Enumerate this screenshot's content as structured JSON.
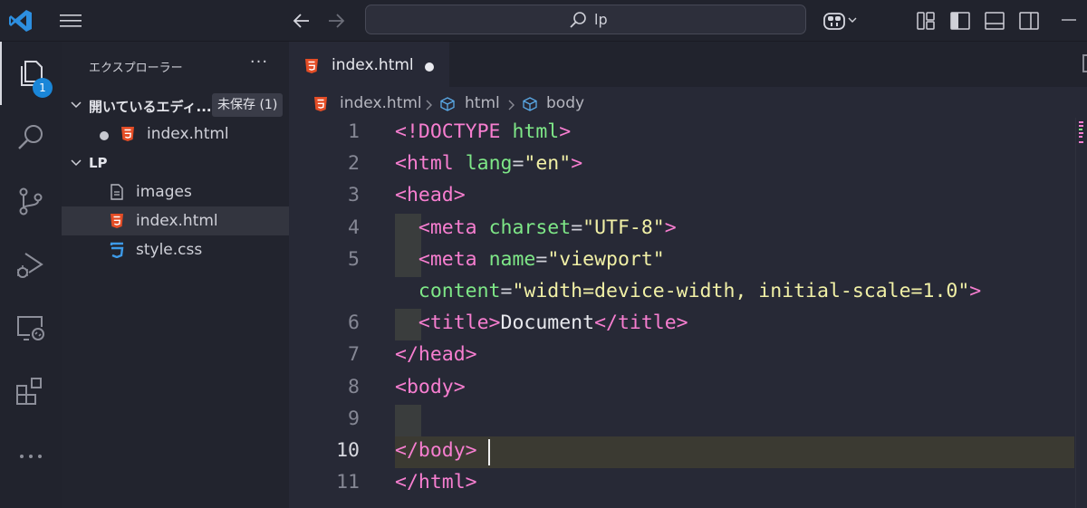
{
  "titlebar": {
    "search_text": "lp",
    "icons": [
      "vscode-logo-icon",
      "hamburger-menu-icon",
      "arrow-left-icon",
      "arrow-right-icon",
      "search-icon",
      "copilot-icon",
      "chevron-down-icon",
      "customize-layout-icon",
      "toggle-primary-sidebar-icon",
      "toggle-panel-icon",
      "toggle-secondary-sidebar-icon",
      "minimize-icon"
    ]
  },
  "activitybar": {
    "explorer_badge": "1",
    "items": [
      "explorer-icon",
      "search-icon",
      "source-control-icon",
      "run-debug-icon",
      "remote-explorer-icon",
      "extensions-icon",
      "more-icon"
    ]
  },
  "sidebar": {
    "title": "エクスプローラー",
    "more": "···",
    "open_editors": {
      "label": "開いているエディ...",
      "unsaved_badge": "未保存 (1)",
      "files": [
        {
          "name": "index.html",
          "dirty": true
        }
      ]
    },
    "folder": {
      "label": "LP",
      "items": [
        {
          "name": "images",
          "icon": "file-icon"
        },
        {
          "name": "index.html",
          "icon": "html5-icon"
        },
        {
          "name": "style.css",
          "icon": "css3-icon"
        }
      ]
    }
  },
  "editor": {
    "tab": {
      "name": "index.html",
      "dirty": true
    },
    "breadcrumb": [
      "index.html",
      "html",
      "body"
    ],
    "current_line": "10",
    "lines": [
      {
        "n": "1",
        "tokens": [
          [
            "t-tag",
            "<!DOCTYPE"
          ],
          [
            "t-plain",
            " "
          ],
          [
            "t-attr",
            "html"
          ],
          [
            "t-tag",
            ">"
          ]
        ]
      },
      {
        "n": "2",
        "tokens": [
          [
            "t-tag",
            "<html"
          ],
          [
            "t-plain",
            " "
          ],
          [
            "t-attr",
            "lang"
          ],
          [
            "t-eq",
            "="
          ],
          [
            "t-str",
            "\"en\""
          ],
          [
            "t-tag",
            ">"
          ]
        ]
      },
      {
        "n": "3",
        "tokens": [
          [
            "t-tag",
            "<head>"
          ]
        ]
      },
      {
        "n": "4",
        "indent": true,
        "tokens": [
          [
            "t-plain",
            "  "
          ],
          [
            "t-tag",
            "<meta"
          ],
          [
            "t-plain",
            " "
          ],
          [
            "t-attr",
            "charset"
          ],
          [
            "t-eq",
            "="
          ],
          [
            "t-str",
            "\"UTF-8\""
          ],
          [
            "t-tag",
            ">"
          ]
        ]
      },
      {
        "n": "5",
        "indent": true,
        "tokens": [
          [
            "t-plain",
            "  "
          ],
          [
            "t-tag",
            "<meta"
          ],
          [
            "t-plain",
            " "
          ],
          [
            "t-attr",
            "name"
          ],
          [
            "t-eq",
            "="
          ],
          [
            "t-str",
            "\"viewport\""
          ]
        ]
      },
      {
        "n": "",
        "tokens": [
          [
            "t-plain",
            "  "
          ],
          [
            "t-attr",
            "content"
          ],
          [
            "t-eq",
            "="
          ],
          [
            "t-str",
            "\"width=device-width, initial-scale=1.0\""
          ],
          [
            "t-tag",
            ">"
          ]
        ]
      },
      {
        "n": "6",
        "indent": true,
        "tokens": [
          [
            "t-plain",
            "  "
          ],
          [
            "t-tag",
            "<title>"
          ],
          [
            "t-plain",
            "Document"
          ],
          [
            "t-tag",
            "</title>"
          ]
        ]
      },
      {
        "n": "7",
        "tokens": [
          [
            "t-tag",
            "</head>"
          ]
        ]
      },
      {
        "n": "8",
        "tokens": [
          [
            "t-tag",
            "<body>"
          ]
        ]
      },
      {
        "n": "9",
        "indent": true,
        "tokens": []
      },
      {
        "n": "10",
        "current": true,
        "tokens": [
          [
            "t-tag",
            "</body>"
          ]
        ]
      },
      {
        "n": "11",
        "tokens": [
          [
            "t-tag",
            "</html>"
          ]
        ]
      }
    ]
  },
  "colors": {
    "accent": "#1a86d8",
    "html_icon": "#e44d26",
    "css_icon": "#3d9ae8",
    "tag": "#f77ed0",
    "attribute": "#7ee787",
    "string": "#f1f0a6"
  }
}
